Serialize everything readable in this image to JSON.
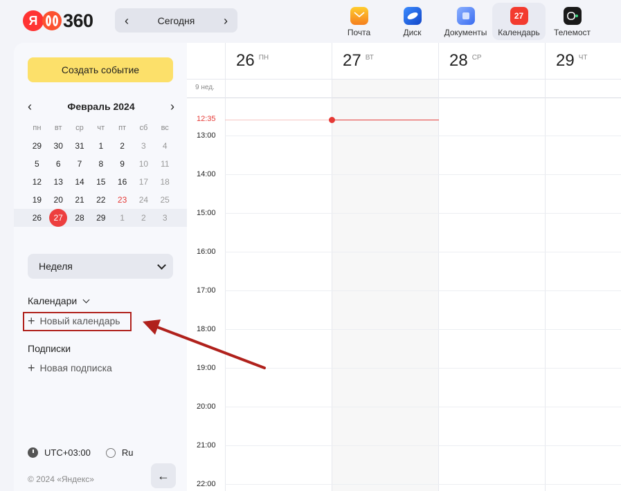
{
  "logo": {
    "ya": "Я",
    "number": "360"
  },
  "nav": {
    "today_label": "Сегодня",
    "prev": "‹",
    "next": "›"
  },
  "apps": [
    {
      "label": "Почта",
      "icon": "mail-icon"
    },
    {
      "label": "Диск",
      "icon": "disk-icon"
    },
    {
      "label": "Документы",
      "icon": "documents-icon"
    },
    {
      "label": "Календарь",
      "icon": "calendar-icon",
      "badge": "27",
      "active": true
    },
    {
      "label": "Телемост",
      "icon": "telemost-icon"
    }
  ],
  "sidebar": {
    "create_label": "Создать событие",
    "mini_calendar": {
      "month": "Февраль 2024",
      "weekdays": [
        "пн",
        "вт",
        "ср",
        "чт",
        "пт",
        "сб",
        "вс"
      ],
      "weeks": [
        [
          "29",
          "30",
          "31",
          "1",
          "2",
          "3",
          "4"
        ],
        [
          "5",
          "6",
          "7",
          "8",
          "9",
          "10",
          "11"
        ],
        [
          "12",
          "13",
          "14",
          "15",
          "16",
          "17",
          "18"
        ],
        [
          "19",
          "20",
          "21",
          "22",
          "23",
          "24",
          "25"
        ],
        [
          "26",
          "27",
          "28",
          "29",
          "1",
          "2",
          "3"
        ]
      ],
      "today": "27"
    },
    "view_label": "Неделя",
    "calendars_title": "Календари",
    "new_calendar": "Новый календарь",
    "subscriptions_title": "Подписки",
    "new_subscription": "Новая подписка",
    "timezone": "UTC+03:00",
    "language": "Ru",
    "copyright": "© 2024 «Яндекс»",
    "collapse_icon": "←"
  },
  "calendar": {
    "week_label": "9 нед.",
    "days": [
      {
        "num": "26",
        "dow": "ПН"
      },
      {
        "num": "27",
        "dow": "ВТ"
      },
      {
        "num": "28",
        "dow": "СР"
      },
      {
        "num": "29",
        "dow": "ЧТ"
      }
    ],
    "now_time": "12:35",
    "hours": [
      "13:00",
      "14:00",
      "15:00",
      "16:00",
      "17:00",
      "18:00",
      "19:00",
      "20:00",
      "21:00",
      "22:00"
    ],
    "accent_color": "#e53935"
  }
}
